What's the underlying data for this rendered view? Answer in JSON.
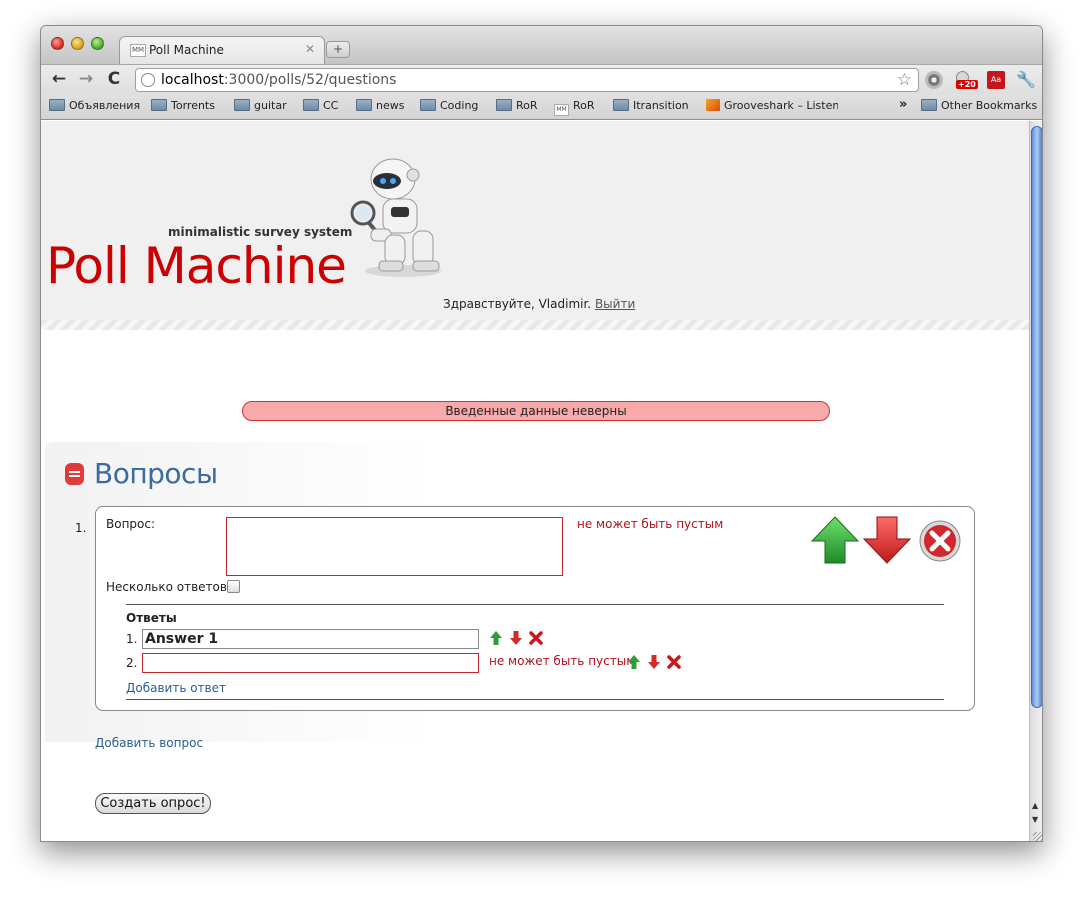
{
  "browser": {
    "tab_title": "Poll Machine",
    "tab_favicon": "MM",
    "tab_close": "✕",
    "new_tab": "+",
    "url_host": "localhost",
    "url_rest": ":3000/polls/52/questions",
    "back": "←",
    "forward": "→",
    "reload": "C",
    "star": "☆",
    "ext_badge": "+20",
    "ext_adobe": "Aa",
    "wrench": "🔧",
    "bookmarks": [
      {
        "label": "Объявления",
        "icon": "folder-icon"
      },
      {
        "label": "Torrents",
        "icon": "folder-icon"
      },
      {
        "label": "guitar",
        "icon": "folder-icon"
      },
      {
        "label": "CC",
        "icon": "folder-icon"
      },
      {
        "label": "news",
        "icon": "folder-icon"
      },
      {
        "label": "Coding",
        "icon": "folder-icon"
      },
      {
        "label": "RoR",
        "icon": "folder-icon"
      },
      {
        "label": "RoR",
        "icon": "mm-icon"
      },
      {
        "label": "Itransition",
        "icon": "folder-icon"
      },
      {
        "label": "Grooveshark – Listen",
        "icon": "grooveshark-icon"
      }
    ],
    "bookmarks_chevron": "»",
    "other_bookmarks": "Other Bookmarks"
  },
  "header": {
    "tagline": "minimalistic survey system",
    "logo": "Poll Machine",
    "greeting": "Здравствуйте, Vladimir.",
    "logout": "Выйти"
  },
  "flash": "Введенные данные неверны",
  "section": {
    "title": "Вопросы"
  },
  "question": {
    "number": "1.",
    "question_label": "Вопрос:",
    "question_value": "",
    "question_error": "не может быть пустым",
    "multiple_label": "Несколько ответов:",
    "answers_heading": "Ответы",
    "answers": [
      {
        "number": "1.",
        "value": "Answer 1",
        "error": ""
      },
      {
        "number": "2.",
        "value": "",
        "error": "не может быть пустым"
      }
    ],
    "add_answer": "Добавить ответ"
  },
  "add_question": "Добавить вопрос",
  "submit": "Создать опрос!",
  "colors": {
    "brand_red": "#cc0000",
    "title_blue": "#3a6ca3",
    "error_red": "#b5121b",
    "flash_bg": "#f8a9a9"
  }
}
